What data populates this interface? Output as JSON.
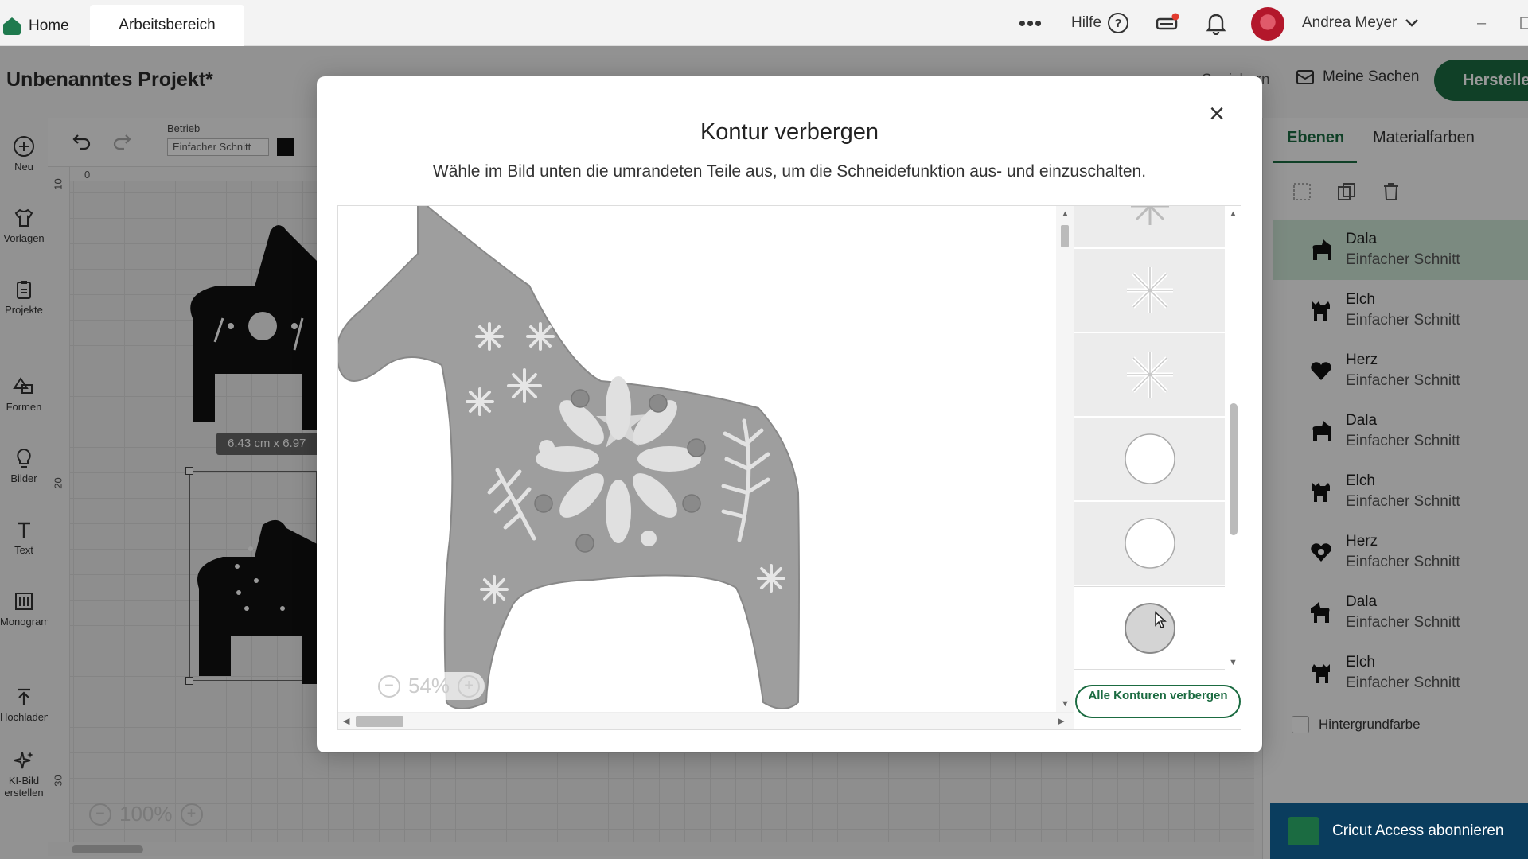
{
  "topbar": {
    "home_label": "Home",
    "workspace_label": "Arbeitsbereich",
    "more_label": "•••",
    "help_label": "Hilfe",
    "help_icon": "?",
    "user_name": "Andrea Meyer",
    "minimize": "–"
  },
  "project": {
    "title": "Unbenanntes Projekt*",
    "save_label": "Speichern",
    "my_stuff_label": "Meine Sachen",
    "make_label": "Herstelle"
  },
  "sidebar": {
    "items": [
      {
        "label": "Neu"
      },
      {
        "label": "Vorlagen"
      },
      {
        "label": "Projekte"
      },
      {
        "label": "Formen"
      },
      {
        "label": "Bilder"
      },
      {
        "label": "Text"
      },
      {
        "label": "Monogramm"
      },
      {
        "label": "Hochladen"
      },
      {
        "label": "KI-Bild erstellen"
      }
    ]
  },
  "toolbar": {
    "operation_label": "Betrieb",
    "operation_value": "Einfacher Schnitt"
  },
  "canvas": {
    "ruler_top_zero": "0",
    "ruler_left": [
      "10",
      "20",
      "30"
    ],
    "dimension": "6.43 cm x 6.97",
    "zoom": "100%"
  },
  "modal": {
    "title": "Kontur verbergen",
    "description": "Wähle im Bild unten die umrandeten Teile aus, um die Schneidefunktion aus- und einzuschalten.",
    "zoom": "54%",
    "hide_all_label": "Alle Konturen verbergen",
    "close_label": "×"
  },
  "right_panel": {
    "tabs": [
      {
        "label": "Ebenen",
        "active": true
      },
      {
        "label": "Materialfarben",
        "active": false
      }
    ],
    "layers": [
      {
        "name": "Dala",
        "op": "Einfacher Schnitt",
        "icon": "horse-icon",
        "active": true
      },
      {
        "name": "Elch",
        "op": "Einfacher Schnitt",
        "icon": "moose-icon",
        "active": false
      },
      {
        "name": "Herz",
        "op": "Einfacher Schnitt",
        "icon": "heart-icon",
        "active": false
      },
      {
        "name": "Dala",
        "op": "Einfacher Schnitt",
        "icon": "horse-icon",
        "active": false
      },
      {
        "name": "Elch",
        "op": "Einfacher Schnitt",
        "icon": "moose-icon",
        "active": false
      },
      {
        "name": "Herz",
        "op": "Einfacher Schnitt",
        "icon": "heart-icon",
        "active": false
      },
      {
        "name": "Dala",
        "op": "Einfacher Schnitt",
        "icon": "horse-icon",
        "active": false
      },
      {
        "name": "Elch",
        "op": "Einfacher Schnitt",
        "icon": "moose-icon",
        "active": false
      }
    ],
    "background_label": "Hintergrundfarbe",
    "subscribe_label": "Cricut Access abonnieren"
  },
  "colors": {
    "accent": "#1b6b41",
    "active_layer": "#cde7d6",
    "subscribe_bg": "#0a3d5e"
  }
}
